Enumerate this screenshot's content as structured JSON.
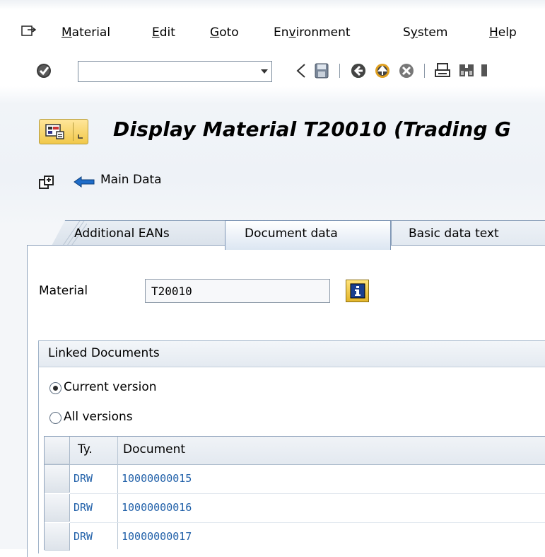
{
  "menu": {
    "items": [
      "Material",
      "Edit",
      "Goto",
      "Environment",
      "System",
      "Help"
    ],
    "mnemonics": [
      "M",
      "E",
      "G",
      "v",
      "y",
      "H"
    ]
  },
  "toolbar": {
    "command_field_value": "",
    "icons": [
      "enter-icon",
      "dropdown-icon",
      "back-arrow-icon",
      "save-icon",
      "back-icon",
      "exit-icon",
      "cancel-icon",
      "print-icon",
      "find-icon"
    ]
  },
  "title": {
    "text": "Display Material T20010 (Trading G"
  },
  "app_toolbar": {
    "main_data_label": "Main Data"
  },
  "tabs": [
    {
      "label": "Additional EANs",
      "active": false
    },
    {
      "label": "Document data",
      "active": true
    },
    {
      "label": "Basic data text",
      "active": false
    }
  ],
  "material": {
    "label": "Material",
    "value": "T20010"
  },
  "linked_documents": {
    "title": "Linked Documents",
    "radio_current": "Current version",
    "radio_all": "All versions",
    "selected": "current",
    "columns": [
      "Ty.",
      "Document"
    ],
    "rows": [
      {
        "type": "DRW",
        "document": "10000000015"
      },
      {
        "type": "DRW",
        "document": "10000000016"
      },
      {
        "type": "DRW",
        "document": "10000000017"
      }
    ]
  },
  "colors": {
    "link_blue": "#1f5fa8",
    "tab_border": "#8fa3bc",
    "button_yellow": "#f1c84a"
  }
}
